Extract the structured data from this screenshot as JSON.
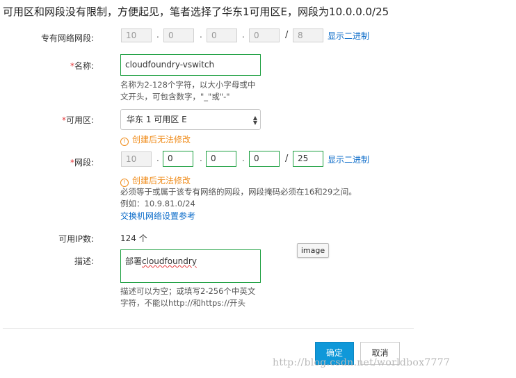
{
  "intro_text": "可用区和网段没有限制，方便起见，笔者选择了华东1可用区E，网段为10.0.0.0/25",
  "vpc_cidr": {
    "label": "专有网络网段:",
    "octets": [
      "10",
      "0",
      "0",
      "0"
    ],
    "mask": "8",
    "binary_link": "显示二进制"
  },
  "name": {
    "required_mark": "*",
    "label": "名称:",
    "value": "cloudfoundry-vswitch",
    "help_line1": "名称为2-128个字符，以大小字母或中",
    "help_line2": "文开头，可包含数字，\"_\"或\"-\""
  },
  "zone": {
    "required_mark": "*",
    "label": "可用区:",
    "value": "华东 1 可用区 E",
    "warning": "创建后无法修改"
  },
  "cidr": {
    "required_mark": "*",
    "label": "网段:",
    "octets": [
      "10",
      "0",
      "0",
      "0"
    ],
    "mask": "25",
    "binary_link": "显示二进制",
    "warning": "创建后无法修改",
    "help_line1": "必须等于或属于该专有网络的网段，网段掩码必须在16和29之间。",
    "help_line2": "例如：10.9.81.0/24",
    "ref_link": "交换机网络设置参考"
  },
  "available_ip": {
    "label": "可用IP数:",
    "value": "124 个"
  },
  "tooltip_text": "image",
  "description": {
    "label": "描述:",
    "value_prefix": "部署",
    "value_word": "cloudfoundry",
    "help_line1": "描述可以为空；或填写2-256个中英文",
    "help_line2": "字符，不能以http://和https://开头"
  },
  "buttons": {
    "confirm": "确定",
    "cancel": "取消"
  },
  "watermark": "http://blog.csdn.net/worldbox7777",
  "colors": {
    "accent_green": "#1a9e3e",
    "link_blue": "#0a6bc9",
    "warning_orange": "#f08d1c",
    "required_red": "#e4393c",
    "primary_button": "#0f98d9"
  }
}
